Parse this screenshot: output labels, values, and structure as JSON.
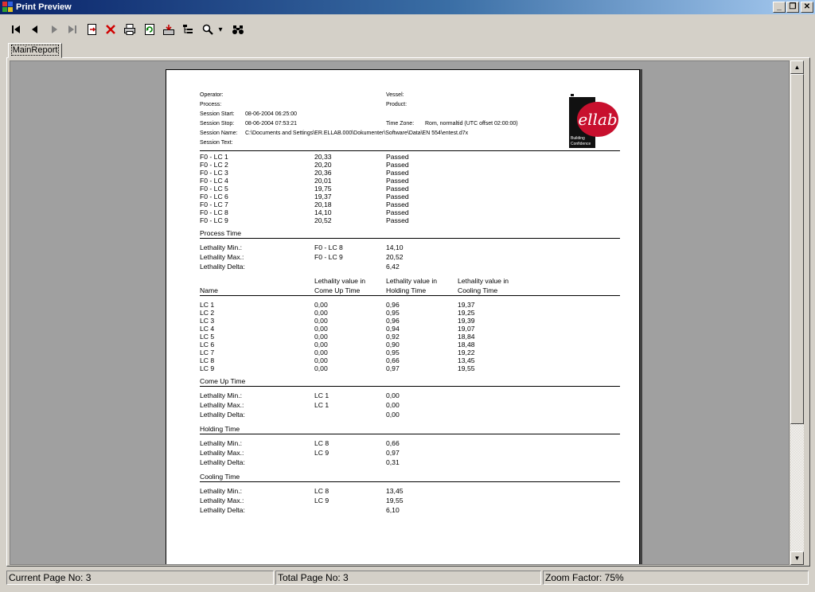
{
  "window": {
    "title": "Print Preview",
    "minimize": "_",
    "restore": "❐",
    "close": "✕"
  },
  "toolbar": {
    "buttons": [
      "first-page",
      "previous-page",
      "next-page",
      "last-page",
      "go-to-page",
      "close-report",
      "print",
      "refresh",
      "export",
      "toggle-tree",
      "zoom",
      "zoom-dropdown",
      "search"
    ],
    "zoom_arrow": "▾"
  },
  "tab": {
    "label": "MainReport"
  },
  "report": {
    "header": {
      "operator_label": "Operator:",
      "process_label": "Process:",
      "session_start_label": "Session Start:",
      "session_start_value": "08-06-2004 06:25:00",
      "session_stop_label": "Session Stop:",
      "session_stop_value": "08-06-2004 07:53:21",
      "session_name_label": "Session Name:",
      "session_name_value": "C:\\Documents and Settings\\ER.ELLAB.000\\Dokumenter\\Software\\Data\\EN 554\\entest.d7x",
      "session_text_label": "Session Text:",
      "vessel_label": "Vessel:",
      "product_label": "Product:",
      "time_zone_label": "Time Zone:",
      "time_zone_value": "Rom, normaltid (UTC offset 02:00:00)"
    },
    "logo": {
      "brand": "ellab",
      "tagline_1": "Building",
      "tagline_2": "Confidence"
    },
    "f0_results": [
      {
        "name": "F0 - LC 1",
        "value": "20,33",
        "status": "Passed"
      },
      {
        "name": "F0 - LC 2",
        "value": "20,20",
        "status": "Passed"
      },
      {
        "name": "F0 - LC 3",
        "value": "20,36",
        "status": "Passed"
      },
      {
        "name": "F0 - LC 4",
        "value": "20,01",
        "status": "Passed"
      },
      {
        "name": "F0 - LC 5",
        "value": "19,75",
        "status": "Passed"
      },
      {
        "name": "F0 - LC 6",
        "value": "19,37",
        "status": "Passed"
      },
      {
        "name": "F0 - LC 7",
        "value": "20,18",
        "status": "Passed"
      },
      {
        "name": "F0 - LC 8",
        "value": "14,10",
        "status": "Passed"
      },
      {
        "name": "F0 - LC 9",
        "value": "20,52",
        "status": "Passed"
      }
    ],
    "process_time": {
      "title": "Process Time",
      "min_label": "Lethality Min.:",
      "min_source": "F0 - LC 8",
      "min_value": "14,10",
      "max_label": "Lethality Max.:",
      "max_source": "F0 - LC 9",
      "max_value": "20,52",
      "delta_label": "Lethality Delta:",
      "delta_value": "6,42"
    },
    "lethality_table": {
      "col_name": "Name",
      "col_comeup_1": "Lethality value in",
      "col_comeup_2": "Come Up Time",
      "col_holding_1": "Lethality value in",
      "col_holding_2": "Holding Time",
      "col_cooling_1": "Lethality value in",
      "col_cooling_2": "Cooling Time",
      "rows": [
        {
          "name": "LC 1",
          "comeup": "0,00",
          "holding": "0,96",
          "cooling": "19,37"
        },
        {
          "name": "LC 2",
          "comeup": "0,00",
          "holding": "0,95",
          "cooling": "19,25"
        },
        {
          "name": "LC 3",
          "comeup": "0,00",
          "holding": "0,96",
          "cooling": "19,39"
        },
        {
          "name": "LC 4",
          "comeup": "0,00",
          "holding": "0,94",
          "cooling": "19,07"
        },
        {
          "name": "LC 5",
          "comeup": "0,00",
          "holding": "0,92",
          "cooling": "18,84"
        },
        {
          "name": "LC 6",
          "comeup": "0,00",
          "holding": "0,90",
          "cooling": "18,48"
        },
        {
          "name": "LC 7",
          "comeup": "0,00",
          "holding": "0,95",
          "cooling": "19,22"
        },
        {
          "name": "LC 8",
          "comeup": "0,00",
          "holding": "0,66",
          "cooling": "13,45"
        },
        {
          "name": "LC 9",
          "comeup": "0,00",
          "holding": "0,97",
          "cooling": "19,55"
        }
      ]
    },
    "come_up_time": {
      "title": "Come Up Time",
      "min_label": "Lethality Min.:",
      "min_source": "LC 1",
      "min_value": "0,00",
      "max_label": "Lethality Max.:",
      "max_source": "LC 1",
      "max_value": "0,00",
      "delta_label": "Lethality Delta:",
      "delta_value": "0,00"
    },
    "holding_time": {
      "title": "Holding Time",
      "min_label": "Lethality Min.:",
      "min_source": "LC 8",
      "min_value": "0,66",
      "max_label": "Lethality Max.:",
      "max_source": "LC 9",
      "max_value": "0,97",
      "delta_label": "Lethality Delta:",
      "delta_value": "0,31"
    },
    "cooling_time": {
      "title": "Cooling Time",
      "min_label": "Lethality Min.:",
      "min_source": "LC 8",
      "min_value": "13,45",
      "max_label": "Lethality Max.:",
      "max_source": "LC 9",
      "max_value": "19,55",
      "delta_label": "Lethality Delta:",
      "delta_value": "6,10"
    }
  },
  "status": {
    "current_page": "Current Page No: 3",
    "total_page": "Total Page No: 3",
    "zoom": "Zoom Factor: 75%"
  },
  "colors": {
    "brand_red": "#c8102e",
    "title_bar": "#0a246a",
    "viewer_bg": "#a0a0a0"
  }
}
